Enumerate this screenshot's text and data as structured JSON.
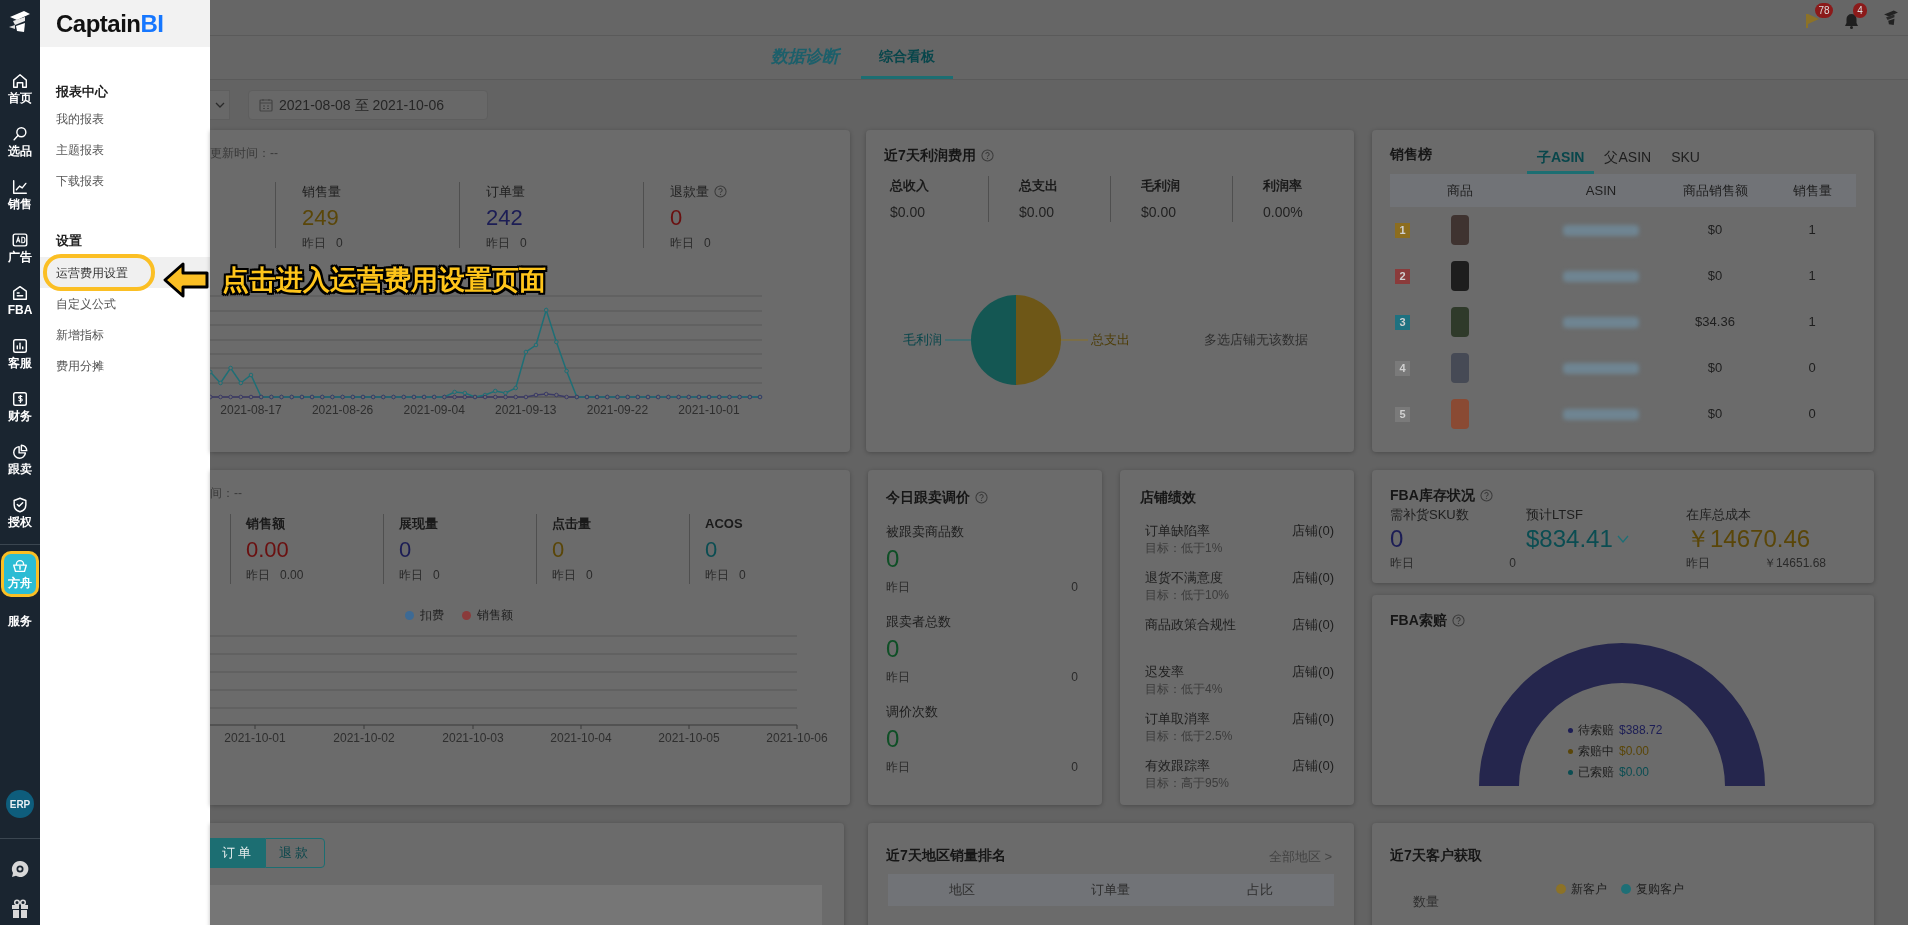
{
  "rail": {
    "groups": [
      {
        "items": [
          {
            "label": "首页",
            "selected": false
          },
          {
            "label": "选品",
            "selected": false
          },
          {
            "label": "销售",
            "selected": false
          },
          {
            "label": "广告",
            "selected": false
          },
          {
            "label": "FBA",
            "selected": false
          },
          {
            "label": "客服",
            "selected": false
          },
          {
            "label": "财务",
            "selected": false
          },
          {
            "label": "跟卖",
            "selected": false
          },
          {
            "label": "授权",
            "selected": false
          }
        ]
      },
      {
        "items": [
          {
            "label": "方舟",
            "selected": true
          },
          {
            "label": "服务",
            "selected": false
          }
        ]
      }
    ],
    "erp": "ERP"
  },
  "menu": {
    "logo": {
      "text": "Captain",
      "accent": "BI"
    },
    "sections": [
      {
        "title": "报表中心",
        "items": [
          {
            "label": "我的报表",
            "selected": false
          },
          {
            "label": "主题报表",
            "selected": false
          },
          {
            "label": "下载报表",
            "selected": false
          }
        ]
      },
      {
        "title": "设置",
        "items": [
          {
            "label": "运营费用设置",
            "selected": true
          },
          {
            "label": "自定义公式",
            "selected": false
          },
          {
            "label": "新增指标",
            "selected": false
          },
          {
            "label": "费用分摊",
            "selected": false
          }
        ]
      }
    ]
  },
  "annotation": {
    "text": "点击进入运营费用设置页面"
  },
  "top_bar": {
    "flag_badge": "78",
    "bell_badge": "4"
  },
  "tabs": [
    {
      "label": "数据诊断",
      "selected": false
    },
    {
      "label": "综合看板",
      "selected": true
    }
  ],
  "filters": {
    "date_range": "2021-08-08 至 2021-10-06"
  },
  "sales_overview": {
    "update_time": "更新时间：--",
    "stats": [
      {
        "label": "销售量",
        "value": "249",
        "color": "#5a4608",
        "yesterday_label": "昨日",
        "yesterday": "0"
      },
      {
        "label": "订单量",
        "value": "242",
        "color": "#1c1d55",
        "yesterday_label": "昨日",
        "yesterday": "0"
      },
      {
        "label": "退款量",
        "help": true,
        "value": "0",
        "color": "#6a1010",
        "yesterday_label": "昨日",
        "yesterday": "0"
      }
    ],
    "x_labels": [
      "2021-08-17",
      "2021-08-26",
      "2021-09-04",
      "2021-09-13",
      "2021-09-22",
      "2021-10-01"
    ]
  },
  "ad_overview": {
    "update_time": "间：--",
    "stats": [
      {
        "label": "销售额",
        "value": "0.00",
        "color": "#6a1010",
        "yesterday_label": "昨日",
        "yesterday": "0.00"
      },
      {
        "label": "展现量",
        "value": "0",
        "color": "#1c1d55",
        "yesterday_label": "昨日",
        "yesterday": "0"
      },
      {
        "label": "点击量",
        "value": "0",
        "color": "#5a4608",
        "yesterday_label": "昨日",
        "yesterday": "0"
      },
      {
        "label": "ACOS",
        "value": "0",
        "color": "#0b4d52",
        "yesterday_label": "昨日",
        "yesterday": "0"
      }
    ],
    "legend": [
      {
        "label": "扣费",
        "color": "#3d6a94"
      },
      {
        "label": "销售额",
        "color": "#8a3b3b"
      }
    ],
    "x_labels": [
      "2021-10-01",
      "2021-10-02",
      "2021-10-03",
      "2021-10-04",
      "2021-10-05",
      "2021-10-06"
    ]
  },
  "orders_panel": {
    "toggle": [
      {
        "label": "订单",
        "selected": true
      },
      {
        "label": "退款",
        "selected": false
      }
    ]
  },
  "profit": {
    "title": "近7天利润费用",
    "help": true,
    "columns": [
      {
        "label": "总收入",
        "value": "$0.00"
      },
      {
        "label": "总支出",
        "value": "$0.00"
      },
      {
        "label": "毛利润",
        "value": "$0.00"
      },
      {
        "label": "利润率",
        "value": "0.00%"
      }
    ],
    "pie": {
      "left_label": "毛利润",
      "right_label": "总支出"
    },
    "note": "多选店铺无该数据"
  },
  "ranking": {
    "title": "销售榜",
    "tabs": [
      {
        "label": "子ASIN",
        "selected": true
      },
      {
        "label": "父ASIN",
        "selected": false
      },
      {
        "label": "SKU",
        "selected": false
      }
    ],
    "columns": [
      "商品",
      "ASIN",
      "商品销售额",
      "销售量"
    ],
    "rows": [
      {
        "rank": "1",
        "color": "#8c6d1f",
        "sales": "$0",
        "quantity": "1"
      },
      {
        "rank": "2",
        "color": "#8a3b3b",
        "sales": "$0",
        "quantity": "1"
      },
      {
        "rank": "3",
        "color": "#1e7180",
        "sales": "$34.36",
        "quantity": "1"
      },
      {
        "rank": "4",
        "color": "#7a7a7a",
        "sales": "$0",
        "quantity": "0"
      },
      {
        "rank": "5",
        "color": "#7a7a7a",
        "sales": "$0",
        "quantity": "0"
      }
    ]
  },
  "follow_sell": {
    "title": "今日跟卖调价",
    "help": true,
    "metrics": [
      {
        "label": "被跟卖商品数",
        "value": "0",
        "yesterday_label": "昨日",
        "yesterday": "0"
      },
      {
        "label": "跟卖者总数",
        "value": "0",
        "yesterday_label": "昨日",
        "yesterday": "0"
      },
      {
        "label": "调价次数",
        "value": "0",
        "yesterday_label": "昨日",
        "yesterday": "0"
      }
    ]
  },
  "store_performance": {
    "title": "店铺绩效",
    "rows": [
      {
        "label": "订单缺陷率",
        "target": "目标：低于1%",
        "status": "店铺(0)"
      },
      {
        "label": "退货不满意度",
        "target": "目标：低于10%",
        "status": "店铺(0)"
      },
      {
        "label": "商品政策合规性",
        "status": "店铺(0)"
      },
      {
        "label": "迟发率",
        "target": "目标：低于4%",
        "status": "店铺(0)"
      },
      {
        "label": "订单取消率",
        "target": "目标：低于2.5%",
        "status": "店铺(0)"
      },
      {
        "label": "有效跟踪率",
        "target": "目标：高于95%",
        "status": "店铺(0)"
      }
    ]
  },
  "fba_inventory": {
    "title": "FBA库存状况",
    "help": true,
    "columns": [
      {
        "label": "需补货SKU数",
        "value": "0",
        "color": "#1c1d55",
        "yesterday_label": "昨日",
        "yesterday": "0"
      },
      {
        "label": "预计LTSF",
        "value": "$834.41",
        "color": "#0b4d52",
        "dropdown": true
      },
      {
        "label": "在库总成本",
        "value": "￥14670.46",
        "color": "#5a4608",
        "yesterday_label": "昨日",
        "yesterday": "￥14651.68"
      }
    ]
  },
  "fba_claims": {
    "title": "FBA索赔",
    "help": true,
    "legend": [
      {
        "label": "待索赔",
        "value": "$388.72",
        "color": "#1c1d55"
      },
      {
        "label": "索赔中",
        "value": "$0.00",
        "color": "#5a4608"
      },
      {
        "label": "已索赔",
        "value": "$0.00",
        "color": "#0b4d52"
      }
    ]
  },
  "region_ranking": {
    "title": "近7天地区销量排名",
    "link": "全部地区 >",
    "columns": [
      "地区",
      "订单量",
      "占比"
    ]
  },
  "customers": {
    "title": "近7天客户获取",
    "legend": [
      {
        "label": "新客户",
        "color": "#8c7227"
      },
      {
        "label": "复购客户",
        "color": "#1e6f76"
      }
    ],
    "axis_label": "数量"
  }
}
